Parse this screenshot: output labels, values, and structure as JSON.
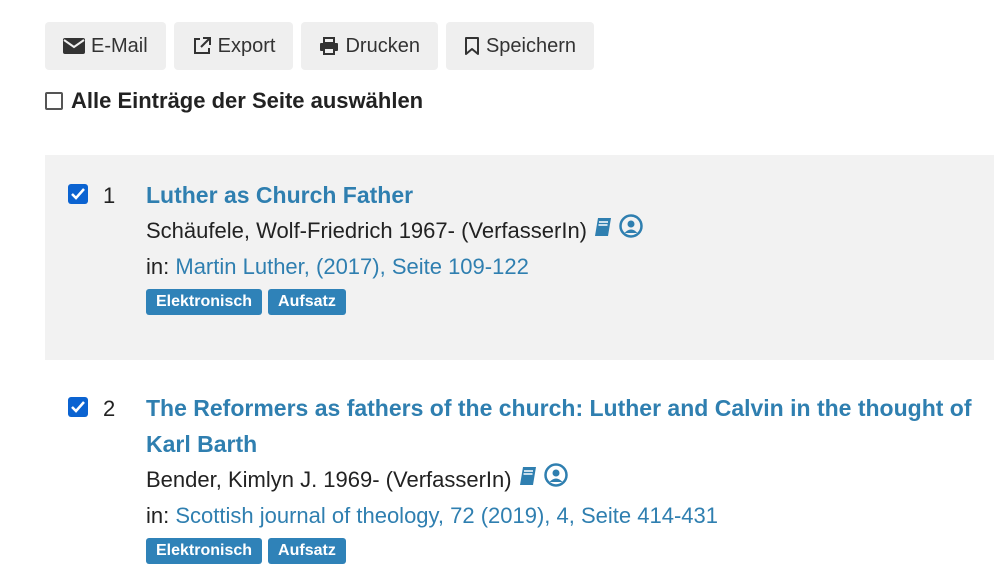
{
  "toolbar": {
    "email_label": "E-Mail",
    "export_label": "Export",
    "print_label": "Drucken",
    "save_label": "Speichern"
  },
  "select_all_label": "Alle Einträge der Seite auswählen",
  "results": [
    {
      "number": "1",
      "title": "Luther as Church Father",
      "author": "Schäufele, Wolf-Friedrich 1967- (VerfasserIn)",
      "in_prefix": "in:",
      "in_link": "Martin Luther, (2017), Seite 109-122",
      "badges": [
        "Elektronisch",
        "Aufsatz"
      ],
      "checked": true
    },
    {
      "number": "2",
      "title": "The Reformers as fathers of the church: Luther and Calvin in the thought of Karl Barth",
      "author": "Bender, Kimlyn J. 1969- (VerfasserIn)",
      "in_prefix": "in:",
      "in_link": "Scottish journal of theology, 72 (2019), 4, Seite 414-431",
      "badges": [
        "Elektronisch",
        "Aufsatz"
      ],
      "checked": true
    }
  ],
  "colors": {
    "link": "#2f7fb0",
    "badge": "#2f82b8",
    "checkbox": "#0b63d1"
  }
}
